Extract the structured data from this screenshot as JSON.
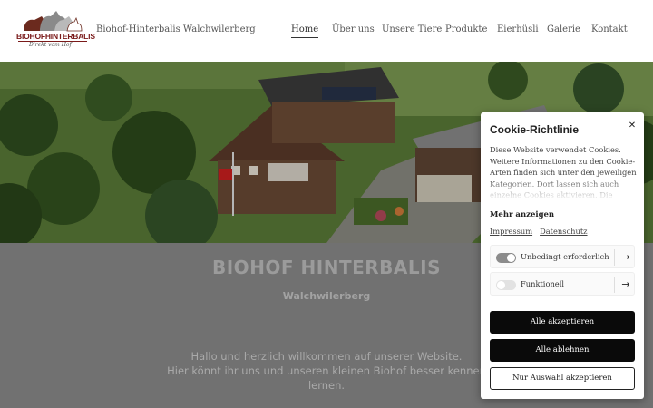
{
  "header": {
    "logo": {
      "brand": "BIOHOFHINTERBALIS",
      "tagline": "Direkt vom Hof"
    },
    "site_name": "Biohof-Hinterbalis Walchwilerberg",
    "nav": [
      "Home",
      "Über uns",
      "Unsere Tiere",
      "Produkte",
      "Eierhüsli",
      "Galerie",
      "Kontakt"
    ],
    "active_nav": "Home"
  },
  "hero": {
    "image": "aerial-farm-photo"
  },
  "main": {
    "title": "BIOHOF HINTERBALIS",
    "subtitle": "Walchwilerberg",
    "welcome_lines": [
      "Hallo und herzlich willkommen auf unserer Website.",
      "Hier könnt ihr uns und unseren kleinen Biohof besser kennen",
      "lernen."
    ]
  },
  "cookie": {
    "title": "Cookie-Richtlinie",
    "close_icon": "close-icon",
    "description": "Diese Website verwendet Cookies. Weitere Informationen zu den Cookie-Arten finden sich unter den jeweiligen Kategorien. Dort lassen sich auch einzelne Cookies aktivieren. Die",
    "more_label": "Mehr anzeigen",
    "links": [
      "Impressum",
      "Datenschutz"
    ],
    "categories": [
      {
        "label": "Unbedingt erforderlich",
        "enabled": true
      },
      {
        "label": "Funktionell",
        "enabled": false
      }
    ],
    "accept_all": "Alle akzeptieren",
    "reject_all": "Alle ablehnen",
    "accept_selection": "Nur Auswahl akzeptieren"
  }
}
